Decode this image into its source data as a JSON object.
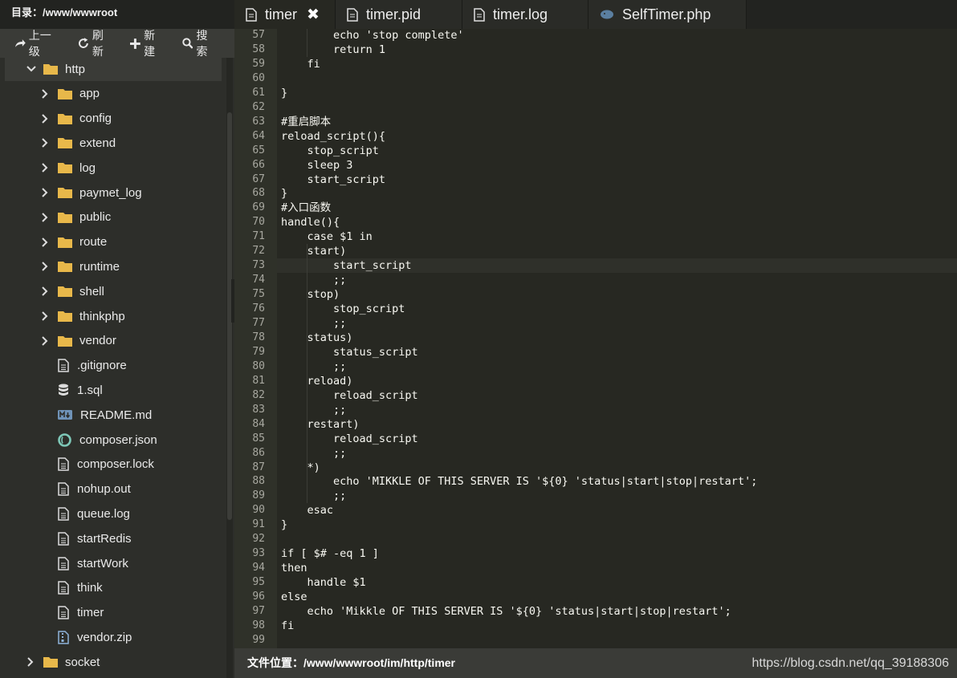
{
  "sidebar": {
    "title": "目录：/www/wwwroot",
    "toolbar": {
      "up_label": "上一级",
      "refresh_label": "刷新",
      "new_label": "新建",
      "search_label": "搜索"
    },
    "tree": [
      {
        "label": "http",
        "type": "folder",
        "expanded": true,
        "depth": 1
      },
      {
        "label": "app",
        "type": "folder",
        "depth": 2
      },
      {
        "label": "config",
        "type": "folder",
        "depth": 2
      },
      {
        "label": "extend",
        "type": "folder",
        "depth": 2
      },
      {
        "label": "log",
        "type": "folder",
        "depth": 2
      },
      {
        "label": "paymet_log",
        "type": "folder",
        "depth": 2
      },
      {
        "label": "public",
        "type": "folder",
        "depth": 2
      },
      {
        "label": "route",
        "type": "folder",
        "depth": 2
      },
      {
        "label": "runtime",
        "type": "folder",
        "depth": 2
      },
      {
        "label": "shell",
        "type": "folder",
        "depth": 2
      },
      {
        "label": "thinkphp",
        "type": "folder",
        "depth": 2
      },
      {
        "label": "vendor",
        "type": "folder",
        "depth": 2
      },
      {
        "label": ".gitignore",
        "type": "file",
        "icon": "file-icon",
        "depth": 2
      },
      {
        "label": "1.sql",
        "type": "file",
        "icon": "database-icon",
        "depth": 2
      },
      {
        "label": "README.md",
        "type": "file",
        "icon": "markdown-icon",
        "depth": 2
      },
      {
        "label": "composer.json",
        "type": "file",
        "icon": "json-icon",
        "depth": 2
      },
      {
        "label": "composer.lock",
        "type": "file",
        "icon": "file-icon",
        "depth": 2
      },
      {
        "label": "nohup.out",
        "type": "file",
        "icon": "file-icon",
        "depth": 2
      },
      {
        "label": "queue.log",
        "type": "file",
        "icon": "file-icon",
        "depth": 2
      },
      {
        "label": "startRedis",
        "type": "file",
        "icon": "file-icon",
        "depth": 2
      },
      {
        "label": "startWork",
        "type": "file",
        "icon": "file-icon",
        "depth": 2
      },
      {
        "label": "think",
        "type": "file",
        "icon": "file-icon",
        "depth": 2
      },
      {
        "label": "timer",
        "type": "file",
        "icon": "file-icon",
        "depth": 2
      },
      {
        "label": "vendor.zip",
        "type": "file",
        "icon": "zip-icon",
        "depth": 2
      },
      {
        "label": "socket",
        "type": "folder",
        "depth": 1
      }
    ]
  },
  "tabs": [
    {
      "label": "timer",
      "active": true,
      "closable": true,
      "close_glyph": "✖",
      "icon": "file-icon"
    },
    {
      "label": "timer.pid",
      "active": false,
      "icon": "file-icon"
    },
    {
      "label": "timer.log",
      "active": false,
      "icon": "file-icon"
    },
    {
      "label": "SelfTimer.php",
      "active": false,
      "icon": "php-icon"
    }
  ],
  "editor": {
    "current_line": 73,
    "highlighted_word": "script",
    "lines": [
      {
        "n": "57",
        "text": "        echo 'stop complete'"
      },
      {
        "n": "58",
        "text": "        return 1"
      },
      {
        "n": "59",
        "text": "    fi"
      },
      {
        "n": "60",
        "text": ""
      },
      {
        "n": "61",
        "text": "}"
      },
      {
        "n": "62",
        "text": ""
      },
      {
        "n": "63",
        "text": "#重启脚本"
      },
      {
        "n": "64",
        "text": "reload_script(){"
      },
      {
        "n": "65",
        "text": "    stop_script"
      },
      {
        "n": "66",
        "text": "    sleep 3"
      },
      {
        "n": "67",
        "text": "    start_script"
      },
      {
        "n": "68",
        "text": "}"
      },
      {
        "n": "69",
        "text": "#入口函数"
      },
      {
        "n": "70",
        "text": "handle(){"
      },
      {
        "n": "71",
        "text": "    case $1 in"
      },
      {
        "n": "72",
        "text": "    start)"
      },
      {
        "n": "73",
        "text": "        start_script"
      },
      {
        "n": "74",
        "text": "        ;;"
      },
      {
        "n": "75",
        "text": "    stop)"
      },
      {
        "n": "76",
        "text": "        stop_script"
      },
      {
        "n": "77",
        "text": "        ;;"
      },
      {
        "n": "78",
        "text": "    status)"
      },
      {
        "n": "79",
        "text": "        status_script"
      },
      {
        "n": "80",
        "text": "        ;;"
      },
      {
        "n": "81",
        "text": "    reload)"
      },
      {
        "n": "82",
        "text": "        reload_script"
      },
      {
        "n": "83",
        "text": "        ;;"
      },
      {
        "n": "84",
        "text": "    restart)"
      },
      {
        "n": "85",
        "text": "        reload_script"
      },
      {
        "n": "86",
        "text": "        ;;"
      },
      {
        "n": "87",
        "text": "    *)"
      },
      {
        "n": "88",
        "text": "        echo 'MIKKLE OF THIS SERVER IS '${0} 'status|start|stop|restart';"
      },
      {
        "n": "89",
        "text": "        ;;"
      },
      {
        "n": "90",
        "text": "    esac"
      },
      {
        "n": "91",
        "text": "}"
      },
      {
        "n": "92",
        "text": ""
      },
      {
        "n": "93",
        "text": "if [ $# -eq 1 ]"
      },
      {
        "n": "94",
        "text": "then"
      },
      {
        "n": "95",
        "text": "    handle $1"
      },
      {
        "n": "96",
        "text": "else"
      },
      {
        "n": "97",
        "text": "    echo 'Mikkle OF THIS SERVER IS '${0} 'status|start|stop|restart';"
      },
      {
        "n": "98",
        "text": "fi"
      },
      {
        "n": "99",
        "text": ""
      }
    ]
  },
  "statusbar": {
    "path": "文件位置：/www/wwwroot/im/http/timer",
    "watermark": "https://blog.csdn.net/qq_39188306"
  },
  "colors": {
    "editor_bg": "#272822",
    "gutter_bg": "#2f3129",
    "folder": "#e8b84a",
    "sidebar_bg": "#2d2e2a"
  }
}
